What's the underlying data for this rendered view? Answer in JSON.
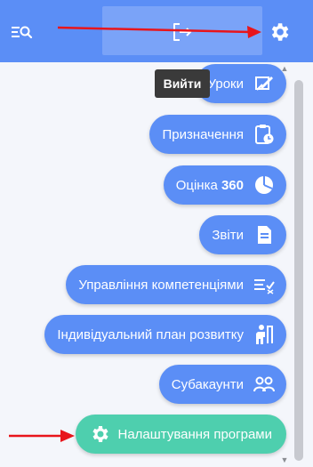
{
  "header": {
    "search_icon": "list-search-icon",
    "logout_icon": "logout-icon",
    "settings_icon": "gear-icon",
    "background_color": "#5b8ef6"
  },
  "tooltip": {
    "text": "Вийти"
  },
  "menu": {
    "items": [
      {
        "label": "Уроки",
        "icon": "lesson-edit-icon"
      },
      {
        "label": "Призначення",
        "icon": "clipboard-clock-icon"
      },
      {
        "label": "Оцінка",
        "label_bold": "360",
        "icon": "pie-chart-icon"
      },
      {
        "label": "Звіти",
        "icon": "report-document-icon"
      },
      {
        "label": "Управління компетенціями",
        "icon": "list-check-icon"
      },
      {
        "label": "Індивідуальний план розвитку",
        "icon": "climb-person-icon"
      },
      {
        "label": "Субакаунти",
        "icon": "users-icon"
      },
      {
        "label": "Налаштування програми",
        "icon": "gear-icon",
        "color": "#4ecfae"
      }
    ]
  },
  "annotation_color": "#e8151b"
}
